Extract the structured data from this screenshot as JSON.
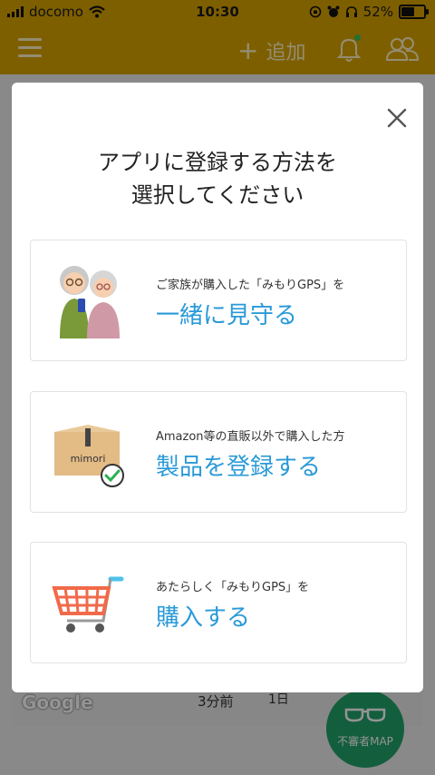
{
  "status_bar": {
    "carrier": "docomo",
    "time": "10:30",
    "battery": "52%",
    "battery_level": 0.52
  },
  "nav": {
    "add_label": "追加",
    "menu_icon": "hamburger-icon",
    "bell_icon": "bell-icon",
    "users_icon": "users-icon"
  },
  "background": {
    "map_logo": "Google",
    "map_time": "3分前",
    "map_day": "1日",
    "suspicious_map_label": "不審者MAP"
  },
  "modal": {
    "title_line1": "アプリに登録する方法を",
    "title_line2": "選択してください",
    "options": [
      {
        "subtitle": "ご家族が購入した「みもりGPS」を",
        "title": "一緒に見守る",
        "icon": "elderly-couple-illustration"
      },
      {
        "subtitle": "Amazon等の直販以外で購入した方",
        "title": "製品を登録する",
        "icon": "package-box-illustration",
        "box_label": "mimori"
      },
      {
        "subtitle": "あたらしく「みもりGPS」を",
        "title": "購入する",
        "icon": "shopping-cart-illustration"
      }
    ]
  },
  "colors": {
    "header": "#d9a400",
    "accent_blue": "#2a9ad8",
    "map_button": "#21a36a"
  }
}
